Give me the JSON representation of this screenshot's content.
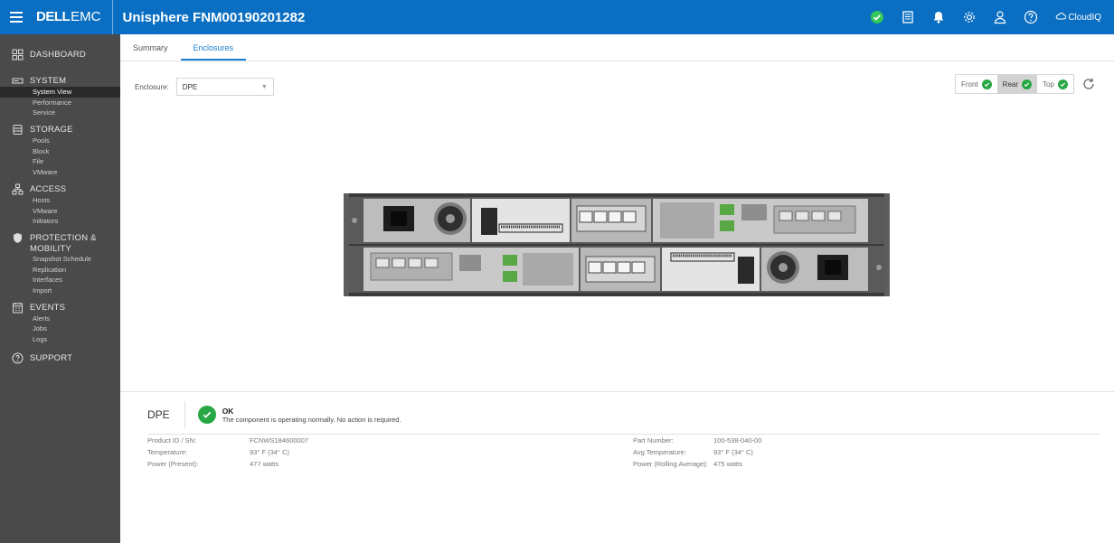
{
  "header": {
    "brand_dell": "DELL",
    "brand_emc": "EMC",
    "title": "Unisphere FNM00190201282",
    "cloudiq_label": "CloudIQ",
    "icons": [
      "ok-status-icon",
      "jobs-icon",
      "alerts-bell-icon",
      "settings-gear-icon",
      "user-icon",
      "help-icon",
      "cloudiq-icon"
    ]
  },
  "sidebar": {
    "sections": [
      {
        "label": "DASHBOARD",
        "icon": "dashboard-grid-icon",
        "items": []
      },
      {
        "label": "SYSTEM",
        "icon": "system-icon",
        "items": [
          "System View",
          "Performance",
          "Service"
        ],
        "active_item": "System View"
      },
      {
        "label": "STORAGE",
        "icon": "storage-icon",
        "items": [
          "Pools",
          "Block",
          "File",
          "VMware"
        ]
      },
      {
        "label": "ACCESS",
        "icon": "access-network-icon",
        "items": [
          "Hosts",
          "VMware",
          "Initiators"
        ]
      },
      {
        "label": "PROTECTION &",
        "label2": "MOBILITY",
        "icon": "shield-icon",
        "items": [
          "Snapshot Schedule",
          "Replication",
          "Interfaces",
          "Import"
        ]
      },
      {
        "label": "EVENTS",
        "icon": "calendar-icon",
        "items": [
          "Alerts",
          "Jobs",
          "Logs"
        ]
      },
      {
        "label": "SUPPORT",
        "icon": "help-circle-icon",
        "items": []
      }
    ]
  },
  "tabs": [
    "Summary",
    "Enclosures"
  ],
  "active_tab": "Enclosures",
  "enclosure": {
    "label": "Enclosure:",
    "value": "DPE"
  },
  "views": [
    {
      "label": "Front",
      "status": "ok"
    },
    {
      "label": "Rear",
      "status": "ok",
      "active": true
    },
    {
      "label": "Top",
      "status": "ok"
    }
  ],
  "details": {
    "title": "DPE",
    "status": "OK",
    "message": "The component is operating normally. No action is required.",
    "left": [
      {
        "key": "Product ID / SN:",
        "value": "FCNWS184600007"
      },
      {
        "key": "Temperature:",
        "value": "93° F (34° C)"
      },
      {
        "key": "Power (Present):",
        "value": "477 watts"
      }
    ],
    "right": [
      {
        "key": "Part Number:",
        "value": "100-538-040-00"
      },
      {
        "key": "Avg Temperature:",
        "value": "93° F (34° C)"
      },
      {
        "key": "Power (Rolling Average):",
        "value": "475 watts"
      }
    ]
  },
  "colors": {
    "topbar": "#0a6fc2",
    "sidebar": "#4a4a4a",
    "accent": "#1a7fd0",
    "ok": "#28a745"
  }
}
